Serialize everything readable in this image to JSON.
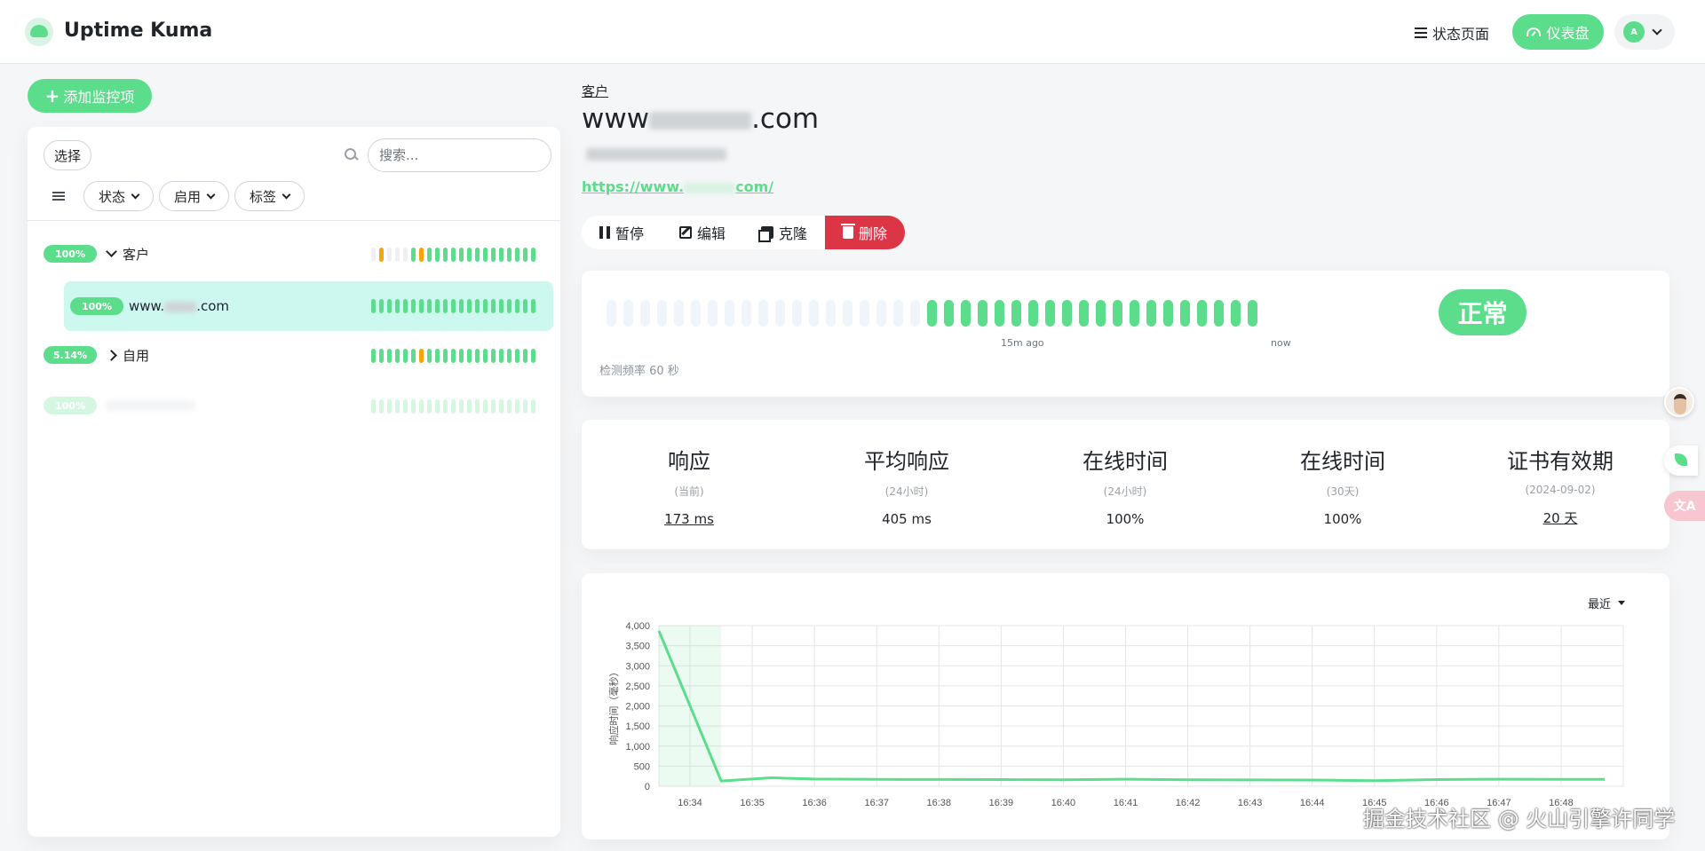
{
  "header": {
    "brand": "Uptime Kuma",
    "status_page_label": "状态页面",
    "dashboard_label": "仪表盘",
    "avatar_letter": "A"
  },
  "sidebar": {
    "add_label": "添加监控项",
    "select_label": "选择",
    "search_placeholder": "搜索...",
    "filters": [
      "状态",
      "启用",
      "标签"
    ],
    "rows": [
      {
        "badge": "100%",
        "name": "客户"
      },
      {
        "badge": "100%",
        "name_prefix": "www.",
        "name_suffix": ".com"
      },
      {
        "badge": "5.14%",
        "name": "自用"
      },
      {
        "badge": "100%",
        "name": ""
      }
    ]
  },
  "monitor": {
    "group": "客户",
    "title_prefix": "www",
    "title_suffix": ".com",
    "url_prefix": "https://www.",
    "url_suffix": "com/",
    "actions": {
      "pause": "暂停",
      "edit": "编辑",
      "clone": "克隆",
      "delete": "删除"
    },
    "beat_left_label": "15m ago",
    "beat_right_label": "now",
    "status": "正常",
    "interval_label": "检测频率 60 秒"
  },
  "stats": [
    {
      "title": "响应",
      "sub": "(当前)",
      "value": "173 ms"
    },
    {
      "title": "平均响应",
      "sub": "(24小时)",
      "value": "405 ms"
    },
    {
      "title": "在线时间",
      "sub": "(24小时)",
      "value": "100%"
    },
    {
      "title": "在线时间",
      "sub": "(30天)",
      "value": "100%"
    },
    {
      "title": "证书有效期",
      "sub": "(2024-09-02)",
      "value": "20 天"
    }
  ],
  "chart_period": "最近",
  "chart_data": {
    "type": "line",
    "ylabel": "响应时间（毫秒）",
    "xlabel": "",
    "ylim": [
      0,
      4000
    ],
    "yticks": [
      "0",
      "500",
      "1,000",
      "1,500",
      "2,000",
      "2,500",
      "3,000",
      "3,500",
      "4,000"
    ],
    "ytick_values": [
      0,
      500,
      1000,
      1500,
      2000,
      2500,
      3000,
      3500,
      4000
    ],
    "x_ticks": [
      "16:34",
      "16:35",
      "16:36",
      "16:37",
      "16:38",
      "16:39",
      "16:40",
      "16:41",
      "16:42",
      "16:43",
      "16:44",
      "16:45",
      "16:46",
      "16:47",
      "16:48"
    ],
    "x_range_minutes": [
      -0.5,
      15.0
    ],
    "points": [
      [
        -0.5,
        3870
      ],
      [
        0.5,
        130
      ],
      [
        1.3,
        210
      ],
      [
        2.0,
        180
      ],
      [
        3.0,
        170
      ],
      [
        4.0,
        168
      ],
      [
        5.0,
        165
      ],
      [
        6.0,
        160
      ],
      [
        7.0,
        175
      ],
      [
        8.0,
        160
      ],
      [
        9.0,
        158
      ],
      [
        10.0,
        155
      ],
      [
        11.0,
        140
      ],
      [
        12.0,
        165
      ],
      [
        13.0,
        175
      ],
      [
        14.0,
        170
      ],
      [
        14.7,
        173
      ]
    ],
    "color": "#5cdd8b",
    "grid": true
  },
  "watermark": "掘金技术社区 @ 火山引擎许同学",
  "colors": {
    "accent": "#5cdd8b",
    "danger": "#dc3545",
    "warning": "#f8a306"
  }
}
